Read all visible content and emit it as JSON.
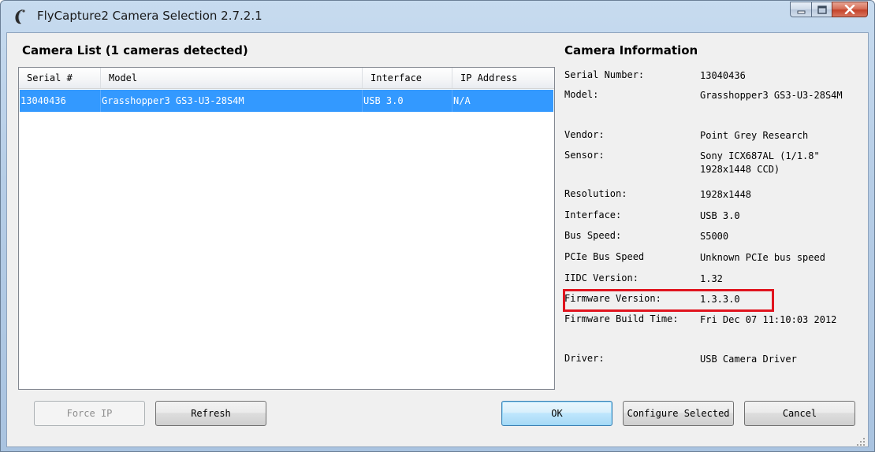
{
  "window": {
    "title": "FlyCapture2 Camera Selection 2.7.2.1",
    "icon": "flycapture-app-icon",
    "caption_buttons": [
      "minimize-icon",
      "maximize-icon",
      "close-icon"
    ]
  },
  "camera_list": {
    "title": "Camera List (1 cameras detected)",
    "columns": [
      "Serial #",
      "Model",
      "Interface",
      "IP Address"
    ],
    "rows": [
      {
        "serial": "13040436",
        "model": "Grasshopper3 GS3-U3-28S4M",
        "interface": "USB 3.0",
        "ip": "N/A",
        "selected": true
      }
    ]
  },
  "camera_info": {
    "title": "Camera Information",
    "fields": [
      {
        "label": "Serial Number:",
        "value": "13040436"
      },
      {
        "label": "Model:",
        "value": "Grasshopper3 GS3-U3-28S4M"
      },
      {
        "label": "Vendor:",
        "value": "Point Grey Research"
      },
      {
        "label": "Sensor:",
        "value": "Sony ICX687AL (1/1.8\" 1928x1448 CCD)"
      },
      {
        "label": "Resolution:",
        "value": "1928x1448"
      },
      {
        "label": "Interface:",
        "value": "USB 3.0"
      },
      {
        "label": "Bus Speed:",
        "value": "S5000"
      },
      {
        "label": "PCIe Bus Speed",
        "value": "Unknown PCIe bus speed"
      },
      {
        "label": "IIDC Version:",
        "value": "1.32"
      },
      {
        "label": "Firmware Version:",
        "value": "1.3.3.0"
      },
      {
        "label": "Firmware Build Time:",
        "value": "Fri Dec 07 11:10:03 2012"
      },
      {
        "label": "Driver:",
        "value": "USB Camera Driver"
      }
    ],
    "highlighted_field": "Firmware Version:",
    "highlight_color": "#e0141e"
  },
  "buttons": {
    "force_ip": "Force IP",
    "refresh": "Refresh",
    "ok": "OK",
    "configure_selected": "Configure Selected",
    "cancel": "Cancel"
  },
  "colors": {
    "selection": "#3399ff",
    "dialog_background": "#f0f0f0"
  }
}
